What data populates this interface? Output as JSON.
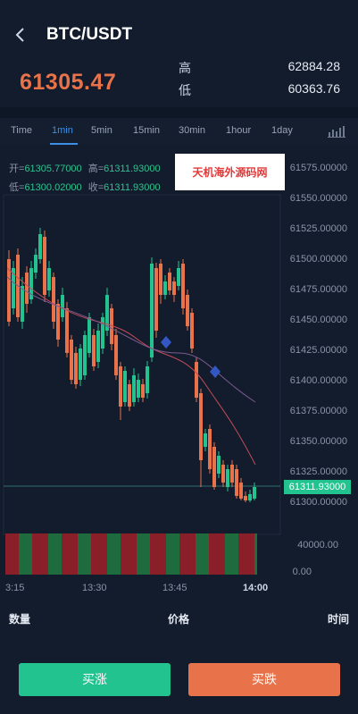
{
  "header": {
    "title": "BTC/USDT",
    "back_icon": "chevron-left-icon"
  },
  "ticker": {
    "last_price": "61305.47",
    "high_label": "高",
    "high_value": "62884.28",
    "low_label": "低",
    "low_value": "60363.76",
    "price_color": "#e8734a"
  },
  "timeframes": {
    "active": "1min",
    "items": [
      "Time",
      "1min",
      "5min",
      "15min",
      "30min",
      "1hour",
      "1day"
    ],
    "indicator_icon": "chart-bars-icon"
  },
  "ohlc": {
    "open_label": "开=",
    "open": "61305.77000",
    "high_label": "高=",
    "high": "61311.93000",
    "low_label": "低=",
    "low": "61300.02000",
    "close_label": "收=",
    "close": "61311.93000"
  },
  "watermark": {
    "text": "天机海外源码网"
  },
  "price_axis": [
    "61575.00000",
    "61550.00000",
    "61525.00000",
    "61500.00000",
    "61475.00000",
    "61450.00000",
    "61425.00000",
    "61400.00000",
    "61375.00000",
    "61350.00000",
    "61325.00000",
    "61300.00000"
  ],
  "current_price_tag": "61311.93000",
  "volume_axis": [
    "40000.00",
    "0.00"
  ],
  "time_axis": [
    "3:15",
    "13:30",
    "13:45",
    "14:00"
  ],
  "trades_header": {
    "qty": "数量",
    "price": "价格",
    "time": "时间"
  },
  "buttons": {
    "buy": "买涨",
    "sell": "买跌"
  },
  "colors": {
    "up": "#22c38e",
    "down": "#e8734a",
    "accent": "#3c8fe3",
    "background": "#121c2c"
  }
}
